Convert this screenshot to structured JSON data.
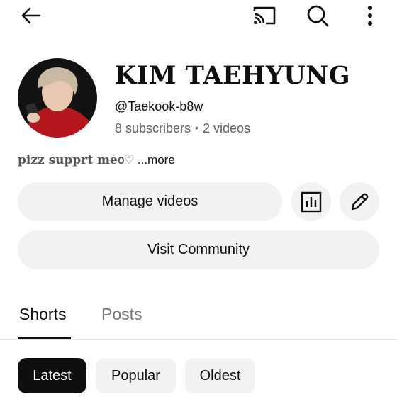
{
  "top_bar": {
    "back_icon": "arrow-left-icon",
    "cast_icon": "cast-icon",
    "search_icon": "search-icon",
    "more_icon": "more-vert-icon"
  },
  "channel": {
    "name": "KIM TAEHYUNG",
    "handle": "@Taekook-b8w",
    "subscribers": "8 subscribers",
    "separator": "•",
    "videos": "2 videos",
    "description": "pizz supprt me൦♡",
    "more_label": "...more"
  },
  "actions": {
    "manage_label": "Manage videos",
    "analytics_icon": "analytics-icon",
    "edit_icon": "pencil-icon",
    "community_label": "Visit Community"
  },
  "tabs": [
    {
      "label": "Shorts",
      "active": true
    },
    {
      "label": "Posts",
      "active": false
    }
  ],
  "filters": [
    {
      "label": "Latest",
      "selected": true
    },
    {
      "label": "Popular",
      "selected": false
    },
    {
      "label": "Oldest",
      "selected": false
    }
  ],
  "colors": {
    "background": "#ffffff",
    "text": "#0f0f0f",
    "secondary_text": "#606060",
    "pill_bg": "#f2f2f2",
    "chip_selected_bg": "#0f0f0f"
  }
}
